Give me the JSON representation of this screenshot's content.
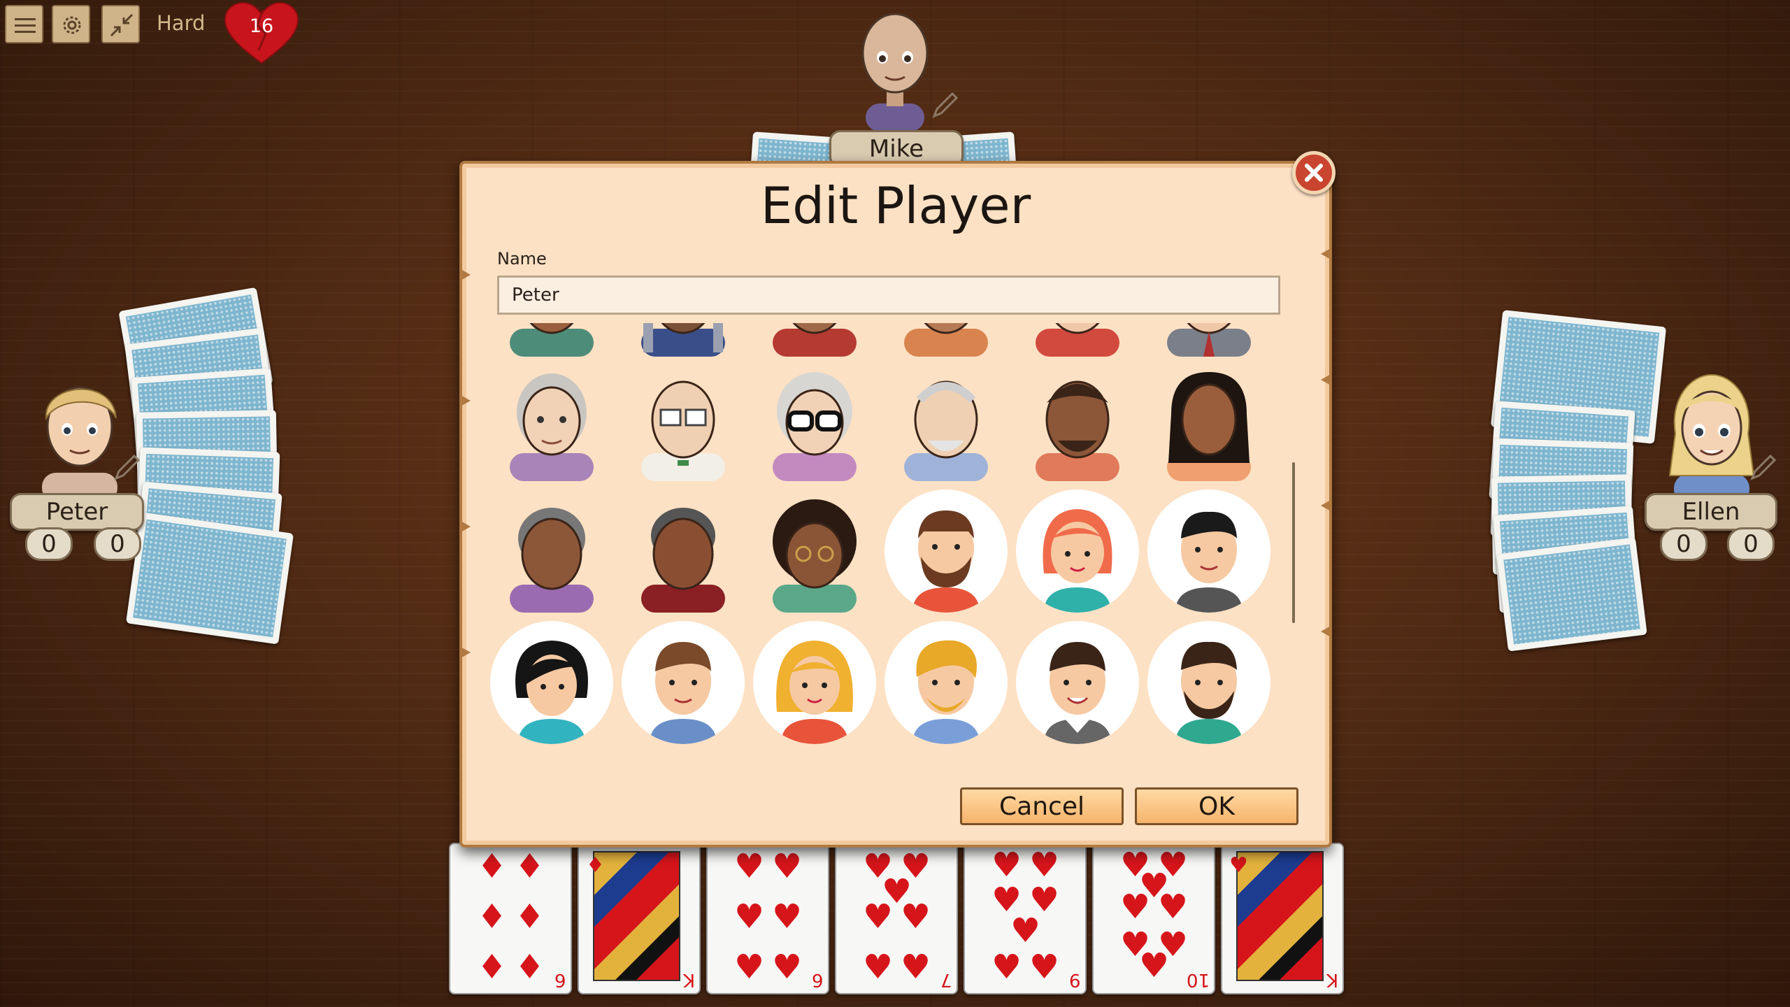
{
  "toolbar": {
    "menu_icon": "hamburger-menu-icon",
    "settings_icon": "gear-icon",
    "minimize_icon": "collapse-arrows-icon",
    "difficulty": "Hard",
    "hearts_count": "16"
  },
  "players": {
    "top": {
      "name": "Mike"
    },
    "left": {
      "name": "Peter",
      "score_round": "0",
      "score_total": "0"
    },
    "right": {
      "name": "Ellen",
      "score_round": "0",
      "score_total": "0"
    }
  },
  "hand": [
    {
      "rank": "6",
      "suit": "diamonds"
    },
    {
      "rank": "K",
      "suit": "diamonds"
    },
    {
      "rank": "6",
      "suit": "hearts"
    },
    {
      "rank": "7",
      "suit": "hearts"
    },
    {
      "rank": "9",
      "suit": "hearts"
    },
    {
      "rank": "10",
      "suit": "hearts"
    },
    {
      "rank": "K",
      "suit": "hearts"
    }
  ],
  "dialog": {
    "title": "Edit Player",
    "name_label": "Name",
    "name_value": "Peter",
    "cancel_label": "Cancel",
    "ok_label": "OK",
    "close_icon": "close-icon"
  },
  "colors": {
    "dialog_bg": "#fde1c4",
    "dialog_border": "#b07a42",
    "button_fill": "#f6b46c",
    "table_wood": "#522b14",
    "card_back": "#7fb6cf",
    "heart_red": "#c8141c"
  }
}
